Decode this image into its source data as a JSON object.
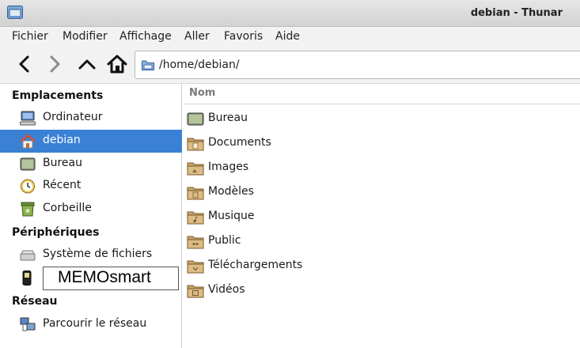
{
  "window": {
    "title": "debian - Thunar"
  },
  "menu": [
    "Fichier",
    "Modifier",
    "Affichage",
    "Aller",
    "Favoris",
    "Aide"
  ],
  "location": {
    "path": "/home/debian/"
  },
  "sidebar": {
    "sections": [
      {
        "title": "Emplacements"
      },
      {
        "title": "Périphériques"
      },
      {
        "title": "Réseau"
      }
    ],
    "items": [
      {
        "label": "Ordinateur",
        "icon": "computer-icon"
      },
      {
        "label": "debian",
        "icon": "home-icon",
        "selected": true
      },
      {
        "label": "Bureau",
        "icon": "desktop-icon"
      },
      {
        "label": "Récent",
        "icon": "recent-clock-icon"
      },
      {
        "label": "Corbeille",
        "icon": "trash-icon"
      },
      {
        "label": "Système de fichiers",
        "icon": "drive-icon"
      },
      {
        "label": "",
        "icon": "phone-device-icon"
      },
      {
        "label": "Parcourir le réseau",
        "icon": "network-icon"
      }
    ],
    "rename_value": "MEMOsmart"
  },
  "main": {
    "column_header": "Nom",
    "files": [
      {
        "name": "Bureau",
        "icon": "desktop-icon"
      },
      {
        "name": "Documents",
        "icon": "folder-documents-icon"
      },
      {
        "name": "Images",
        "icon": "folder-pictures-icon"
      },
      {
        "name": "Modèles",
        "icon": "folder-templates-icon"
      },
      {
        "name": "Musique",
        "icon": "folder-music-icon"
      },
      {
        "name": "Public",
        "icon": "folder-public-icon"
      },
      {
        "name": "Téléchargements",
        "icon": "folder-download-icon"
      },
      {
        "name": "Vidéos",
        "icon": "folder-videos-icon"
      }
    ]
  },
  "colors": {
    "selection": "#3a81d6",
    "folder": "#c9a46a"
  }
}
